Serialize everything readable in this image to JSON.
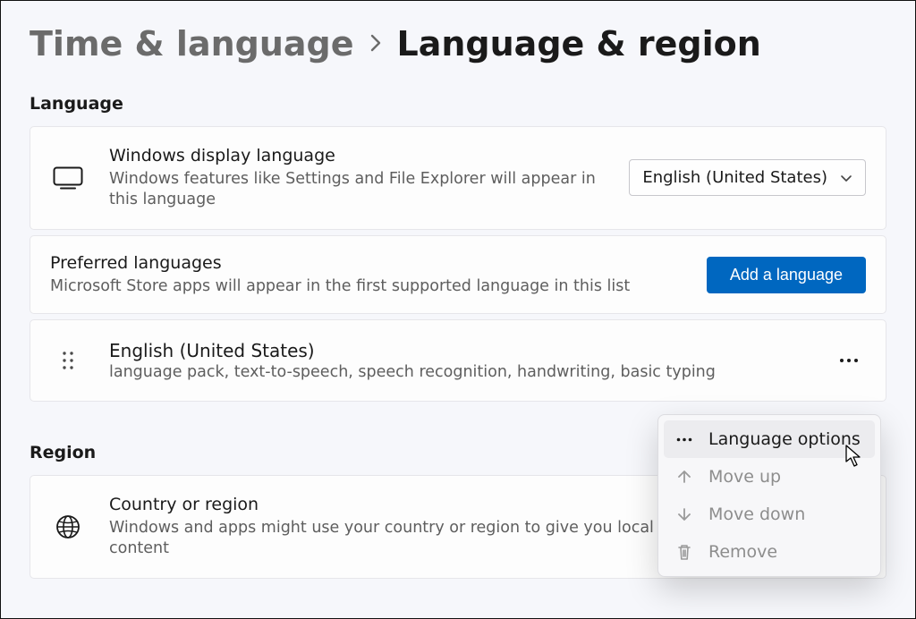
{
  "breadcrumb": {
    "parent": "Time & language",
    "current": "Language & region"
  },
  "sections": {
    "language_header": "Language",
    "region_header": "Region"
  },
  "display_language": {
    "title": "Windows display language",
    "desc": "Windows features like Settings and File Explorer will appear in this language",
    "dropdown_value": "English (United States)"
  },
  "preferred_languages": {
    "title": "Preferred languages",
    "desc": "Microsoft Store apps will appear in the first supported language in this list",
    "add_button": "Add a language"
  },
  "language_entry": {
    "name": "English (United States)",
    "features": "language pack, text-to-speech, speech recognition, handwriting, basic typing"
  },
  "country_region": {
    "title": "Country or region",
    "desc": "Windows and apps might use your country or region to give you local content"
  },
  "context_menu": {
    "options": "Language options",
    "move_up": "Move up",
    "move_down": "Move down",
    "remove": "Remove"
  }
}
